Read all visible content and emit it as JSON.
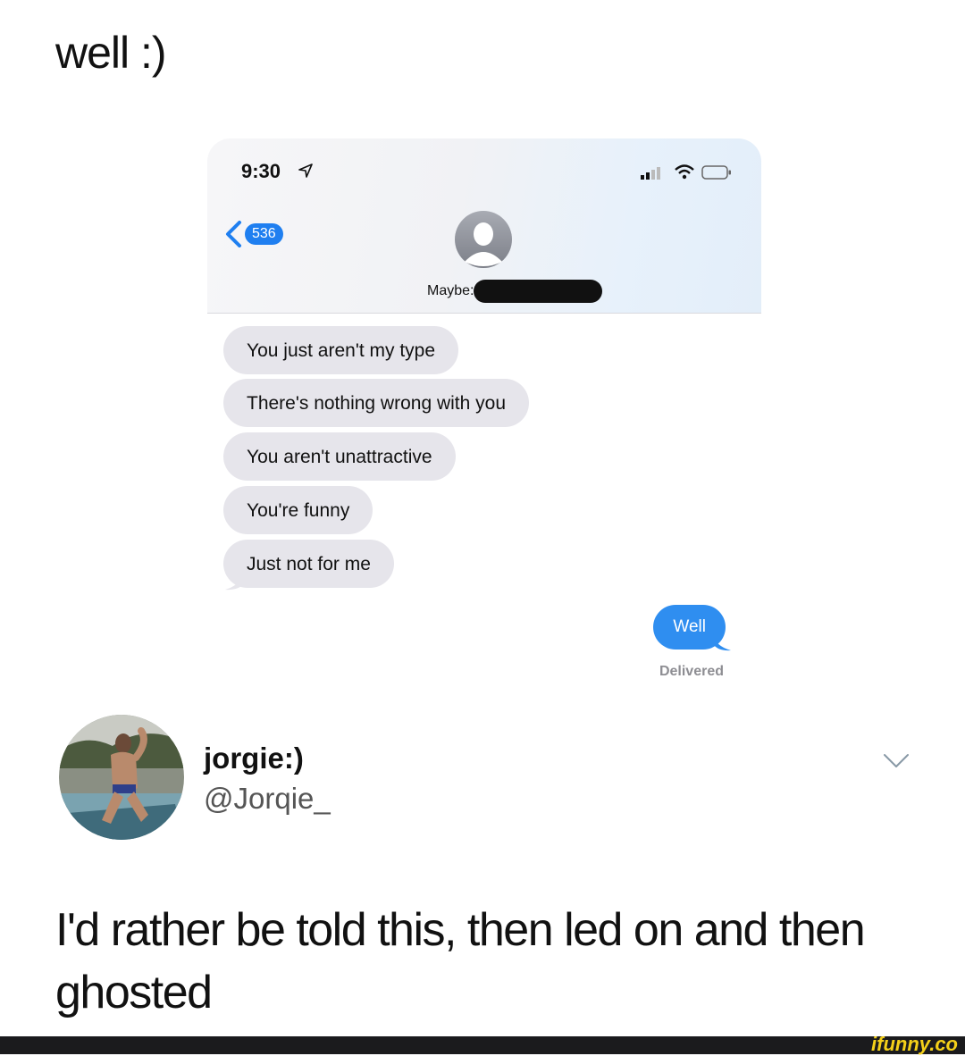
{
  "caption_top": "well :)",
  "phone": {
    "status_time": "9:30",
    "back_badge": "536",
    "contact_label": "Maybe:",
    "messages_in": [
      "You just aren't my type",
      "There's nothing wrong with you",
      "You aren't unattractive",
      "You're funny",
      "Just not for me"
    ],
    "message_out": "Well",
    "delivered": "Delivered"
  },
  "tweet": {
    "name": "jorgie:)",
    "handle": "@Jorqie_",
    "text": "I'd rather be told this, then led on and then ghosted"
  },
  "watermark": "ifunny.co",
  "colors": {
    "imessage_blue": "#2f8ef0",
    "badge_blue": "#1f7ff0",
    "incoming_bubble": "#e6e5eb",
    "watermark_yellow": "#f4d019"
  },
  "icons": [
    "location-arrow-icon",
    "signal-icon",
    "wifi-icon",
    "battery-icon",
    "back-chevron-icon",
    "contact-placeholder-icon",
    "chevron-down-icon"
  ]
}
